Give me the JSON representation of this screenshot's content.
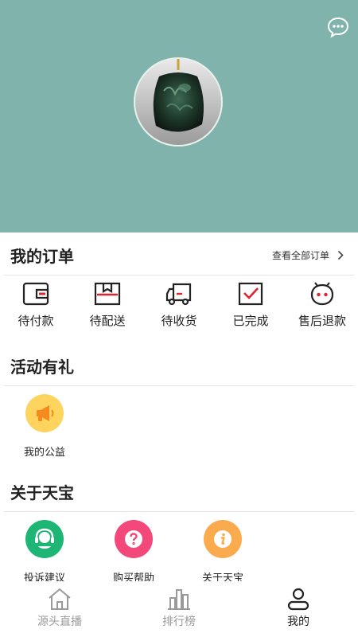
{
  "orders": {
    "title": "我的订单",
    "view_all": "查看全部订单",
    "items": [
      {
        "label": "待付款",
        "icon": "wallet-icon"
      },
      {
        "label": "待配送",
        "icon": "package-icon"
      },
      {
        "label": "待收货",
        "icon": "truck-icon"
      },
      {
        "label": "已完成",
        "icon": "check-box-icon"
      },
      {
        "label": "售后退款",
        "icon": "service-face-icon"
      }
    ]
  },
  "activities": {
    "title": "活动有礼",
    "items": [
      {
        "label": "我的公益",
        "icon": "megaphone-icon",
        "color": "#fcd45e"
      }
    ]
  },
  "about": {
    "title": "关于天宝",
    "items": [
      {
        "label": "投诉建议",
        "icon": "headset-icon",
        "color": "#1db674"
      },
      {
        "label": "购买帮助",
        "icon": "question-icon",
        "color": "#f3497a"
      },
      {
        "label": "关于天宝",
        "icon": "info-icon",
        "color": "#f9ab4d"
      }
    ]
  },
  "tabbar": [
    {
      "label": "源头直播",
      "icon": "home-icon",
      "active": false
    },
    {
      "label": "排行榜",
      "icon": "bar-chart-icon",
      "active": false
    },
    {
      "label": "我的",
      "icon": "user-icon",
      "active": true
    }
  ],
  "colors": {
    "header_bg": "#7fb3ab",
    "accent_red": "#e0242d",
    "tab_inactive": "#9a9a9a",
    "tab_active": "#222222"
  }
}
